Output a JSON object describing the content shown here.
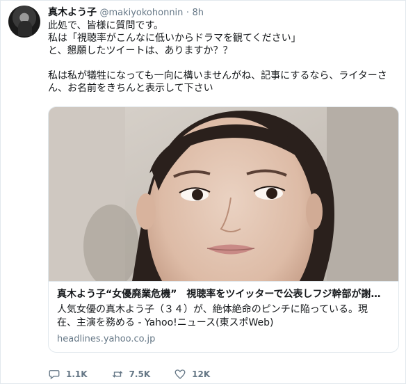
{
  "tweet": {
    "author_name": "真木よう子",
    "author_handle": "@makiyokohonnin",
    "separator": "·",
    "time": "8h",
    "lines": [
      "此処で、皆様に質問です。",
      "私は「視聴率がこんなに低いからドラマを観てください」",
      "と、懇願したツイートは、ありますか？？",
      "",
      "私は私が犠牲になっても一向に構いませんがね、記事にするなら、ライターさ",
      "ん、お名前をきちんと表示して下さい"
    ]
  },
  "card": {
    "title": "真木よう子“女優廃業危機”　視聴率をツイッターで公表しフジ幹部が謝…",
    "description_lines": [
      "人気女優の真木よう子（３４）が、絶体絶命のピンチに陥っている。現",
      "在、主演を務める - Yahoo!ニュース(東スポWeb)"
    ],
    "domain": "headlines.yahoo.co.jp"
  },
  "actions": {
    "reply": {
      "icon": "reply-icon",
      "count": "1.1K"
    },
    "retweet": {
      "icon": "retweet-icon",
      "count": "7.5K"
    },
    "like": {
      "icon": "heart-icon",
      "count": "12K"
    }
  },
  "colors": {
    "text": "#14171a",
    "secondary": "#657786",
    "border": "#e1e8ed"
  }
}
